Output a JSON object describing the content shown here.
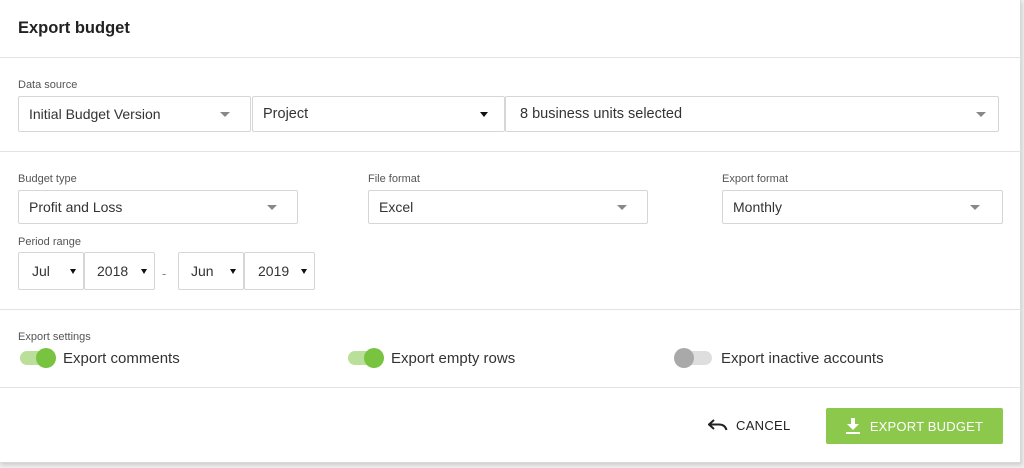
{
  "dialog": {
    "title": "Export budget"
  },
  "data_source": {
    "label": "Data source",
    "version": "Initial Budget Version",
    "dimension": "Project",
    "units": "8 business units selected"
  },
  "budget_type": {
    "label": "Budget type",
    "value": "Profit and Loss"
  },
  "file_format": {
    "label": "File format",
    "value": "Excel"
  },
  "export_format": {
    "label": "Export format",
    "value": "Monthly"
  },
  "period_range": {
    "label": "Period range",
    "start_month": "Jul",
    "start_year": "2018",
    "separator": "-",
    "end_month": "Jun",
    "end_year": "2019"
  },
  "export_settings": {
    "label": "Export settings",
    "toggles": [
      {
        "label": "Export comments",
        "on": true
      },
      {
        "label": "Export empty rows",
        "on": true
      },
      {
        "label": "Export inactive accounts",
        "on": false
      }
    ]
  },
  "actions": {
    "cancel_label": "CANCEL",
    "export_label": "EXPORT BUDGET"
  },
  "colors": {
    "accent": "#8cc84b",
    "toggle_on_knob": "#78c440",
    "toggle_on_track": "#b9df98",
    "toggle_off_knob": "#a9a9a9",
    "toggle_off_track": "#dedede"
  },
  "icons": {
    "cancel": "undo-arrow-icon",
    "export": "download-icon",
    "dropdown": "caret-down-icon"
  }
}
